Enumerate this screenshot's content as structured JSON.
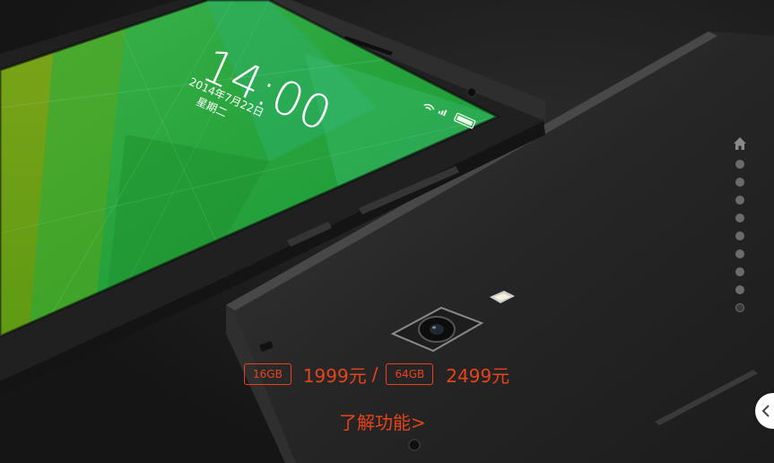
{
  "lockscreen": {
    "time": "14:00",
    "date": "2014年7月22日",
    "weekday": "星期二"
  },
  "pricing": {
    "option1_capacity": "16GB",
    "option1_price": "1999元",
    "separator": "/",
    "option2_capacity": "64GB",
    "option2_price": "2499元"
  },
  "link": {
    "learn_more": "了解功能>"
  },
  "nav": {
    "home_icon": "home-icon",
    "dot_count": 9
  },
  "colors": {
    "accent": "#e8431b",
    "background": "#1a1a1a",
    "screen_green": "#22a33a"
  }
}
